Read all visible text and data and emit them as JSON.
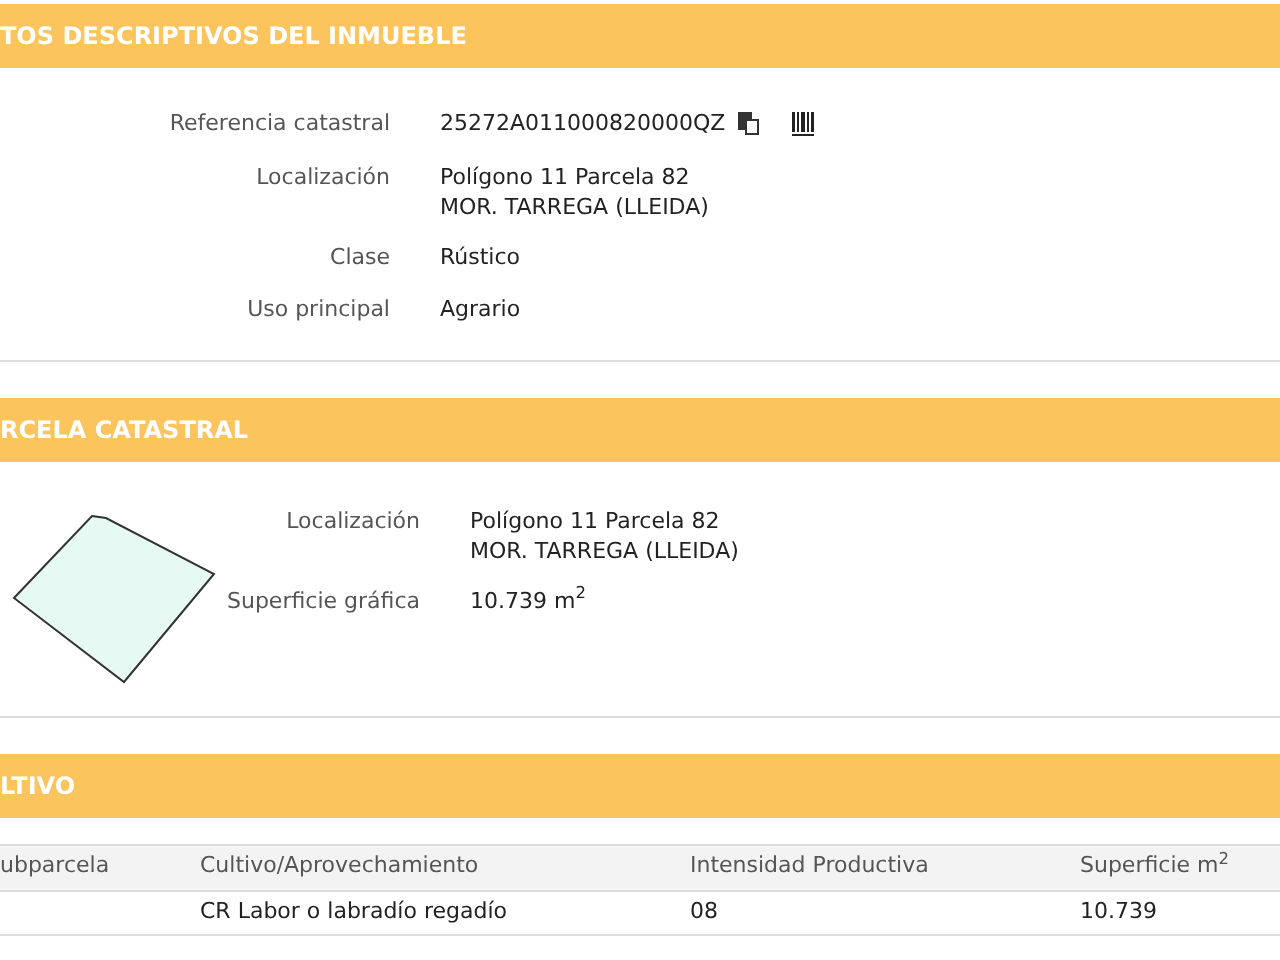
{
  "sections": [
    {
      "title": "TOS DESCRIPTIVOS DEL INMUEBLE",
      "kind": "fields",
      "fields": [
        {
          "label": "Referencia catastral",
          "lines": [
            "25272A011000820000QZ"
          ],
          "icons": true
        },
        {
          "label": "Localización",
          "lines": [
            "Polígono 11 Parcela 82",
            "MOR. TARREGA (LLEIDA)"
          ]
        },
        {
          "label": "Clase",
          "lines": [
            "Rústico"
          ]
        },
        {
          "label": "Uso principal",
          "lines": [
            "Agrario"
          ]
        }
      ]
    },
    {
      "title": "RCELA CATASTRAL",
      "kind": "parcel",
      "fields": [
        {
          "label": "Localización",
          "lines": [
            "Polígono 11 Parcela 82",
            "MOR. TARREGA (LLEIDA)"
          ]
        },
        {
          "label": "Superficie gráfica",
          "lines": [
            "10.739 m$^{2}$"
          ]
        }
      ]
    },
    {
      "title": "LTIVO",
      "kind": "table",
      "table": {
        "columns": [
          "ubparcela",
          "Cultivo/Aprovechamiento",
          "Intensidad Productiva",
          "Superficie m$^{2}$"
        ],
        "rows": [
          [
            "",
            "CR Labor o labradío regadío",
            "08",
            "10.739"
          ]
        ]
      }
    }
  ]
}
